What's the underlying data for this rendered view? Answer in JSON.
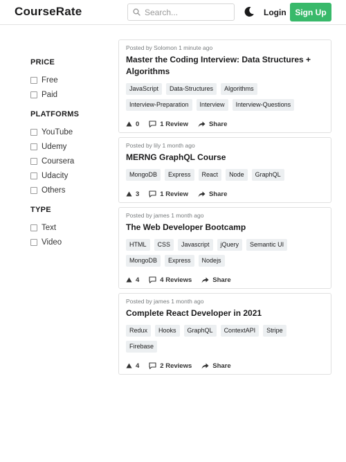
{
  "header": {
    "logo": "CourseRate",
    "search_placeholder": "Search...",
    "login_label": "Login",
    "signup_label": "Sign Up"
  },
  "filters": [
    {
      "title": "PRICE",
      "options": [
        "Free",
        "Paid"
      ]
    },
    {
      "title": "PLATFORMS",
      "options": [
        "YouTube",
        "Udemy",
        "Coursera",
        "Udacity",
        "Others"
      ]
    },
    {
      "title": "TYPE",
      "options": [
        "Text",
        "Video"
      ]
    }
  ],
  "posts": [
    {
      "meta": "Posted by Solomon 1 minute ago",
      "title": "Master the Coding Interview: Data Structures + Algorithms",
      "tags": [
        "JavaScript",
        "Data-Structures",
        "Algorithms",
        "Interview-Preparation",
        "Interview",
        "Interview-Questions"
      ],
      "votes": "0",
      "reviews": "1 Review",
      "share": "Share"
    },
    {
      "meta": "Posted by lily 1 month ago",
      "title": "MERNG GraphQL Course",
      "tags": [
        "MongoDB",
        "Express",
        "React",
        "Node",
        "GraphQL"
      ],
      "votes": "3",
      "reviews": "1 Review",
      "share": "Share"
    },
    {
      "meta": "Posted by james 1 month ago",
      "title": "The Web Developer Bootcamp",
      "tags": [
        "HTML",
        "CSS",
        "Javascript",
        "jQuery",
        "Semantic UI",
        "MongoDB",
        "Express",
        "Nodejs"
      ],
      "votes": "4",
      "reviews": "4 Reviews",
      "share": "Share"
    },
    {
      "meta": "Posted by james 1 month ago",
      "title": "Complete React Developer in 2021",
      "tags": [
        "Redux",
        "Hooks",
        "GraphQL",
        "ContextAPI",
        "Stripe",
        "Firebase"
      ],
      "votes": "4",
      "reviews": "2 Reviews",
      "share": "Share"
    }
  ],
  "colors": {
    "accent": "#38b96a",
    "tag_bg": "#eceff1",
    "muted": "#787c7e"
  },
  "icons": {
    "search": "search-icon",
    "theme": "moon-icon",
    "upvote": "upvote-triangle-icon",
    "comment": "comment-bubble-icon",
    "share": "share-arrow-icon"
  }
}
